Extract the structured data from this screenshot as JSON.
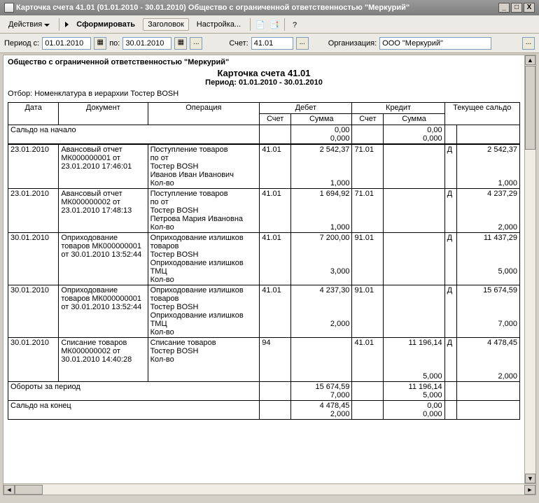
{
  "window": {
    "title": "Карточка счета 41.01 (01.01.2010 - 30.01.2010) Общество с ограниченной ответственностью \"Меркурий\""
  },
  "toolbar": {
    "actions": "Действия",
    "form": "Сформировать",
    "header": "Заголовок",
    "settings": "Настройка..."
  },
  "filter": {
    "period_from_lbl": "Период с:",
    "period_from": "01.01.2010",
    "period_to_lbl": "по:",
    "period_to": "30.01.2010",
    "acct_lbl": "Счет:",
    "acct": "41.01",
    "org_lbl": "Организация:",
    "org": "ООО \"Меркурий\""
  },
  "report": {
    "company": "Общество с ограниченной ответственностью \"Меркурий\"",
    "title": "Карточка счета 41.01",
    "period": "Период: 01.01.2010 - 30.01.2010",
    "selection": "Отбор: Номенклатура в иерархии Тостер BOSH"
  },
  "hdr": {
    "date": "Дата",
    "doc": "Документ",
    "op": "Операция",
    "debit": "Дебет",
    "credit": "Кредит",
    "balance": "Текущее сальдо",
    "acct": "Счет",
    "sum": "Сумма"
  },
  "labels": {
    "start": "Сальдо на начало",
    "turnover": "Обороты за период",
    "end": "Сальдо на конец",
    "d": "Д"
  },
  "start": {
    "d_sum": "0,00",
    "d_qty": "0,000",
    "c_sum": "0,00",
    "c_qty": "0,000"
  },
  "rows": [
    {
      "date": "23.01.2010",
      "doc": "Авансовый отчет МК000000001 от 23.01.2010 17:46:01",
      "op": "Поступление товаров\n  по   от\nТостер BOSH\nИванов Иван Иванович\nКол-во",
      "d_acct": "41.01",
      "d_sum": "2 542,37",
      "d_qty": "1,000",
      "c_acct": "71.01",
      "c_sum": "",
      "c_qty": "",
      "bsign": "Д",
      "bal": "2 542,37",
      "bal_qty": "1,000"
    },
    {
      "date": "23.01.2010",
      "doc": "Авансовый отчет МК000000002 от 23.01.2010 17:48:13",
      "op": "Поступление товаров\n  по   от\nТостер BOSH\nПетрова  Мария Ивановна\nКол-во",
      "d_acct": "41.01",
      "d_sum": "1 694,92",
      "d_qty": "1,000",
      "c_acct": "71.01",
      "c_sum": "",
      "c_qty": "",
      "bsign": "Д",
      "bal": "4 237,29",
      "bal_qty": "2,000"
    },
    {
      "date": "30.01.2010",
      "doc": "Оприходование товаров МК000000001 от 30.01.2010 13:52:44",
      "op": "Оприходование излишков товаров\nТостер BOSH\nОприходование излишков ТМЦ\nКол-во",
      "d_acct": "41.01",
      "d_sum": "7 200,00",
      "d_qty": "3,000",
      "c_acct": "91.01",
      "c_sum": "",
      "c_qty": "",
      "bsign": "Д",
      "bal": "11 437,29",
      "bal_qty": "5,000"
    },
    {
      "date": "30.01.2010",
      "doc": "Оприходование товаров МК000000001 от 30.01.2010 13:52:44",
      "op": "Оприходование излишков товаров\nТостер BOSH\nОприходование излишков ТМЦ\nКол-во",
      "d_acct": "41.01",
      "d_sum": "4 237,30",
      "d_qty": "2,000",
      "c_acct": "91.01",
      "c_sum": "",
      "c_qty": "",
      "bsign": "Д",
      "bal": "15 674,59",
      "bal_qty": "7,000"
    },
    {
      "date": "30.01.2010",
      "doc": "Списание товаров МК000000002 от 30.01.2010 14:40:28",
      "op": "Списание товаров\nТостер BOSH\nКол-во",
      "d_acct": "94",
      "d_sum": "",
      "d_qty": "",
      "c_acct": "41.01",
      "c_sum": "11 196,14",
      "c_qty": "5,000",
      "bsign": "Д",
      "bal": "4 478,45",
      "bal_qty": "2,000"
    }
  ],
  "turnover": {
    "d_sum": "15 674,59",
    "d_qty": "7,000",
    "c_sum": "11 196,14",
    "c_qty": "5,000"
  },
  "end": {
    "d_sum": "4 478,45",
    "d_qty": "2,000",
    "c_sum": "0,00",
    "c_qty": "0,000"
  }
}
